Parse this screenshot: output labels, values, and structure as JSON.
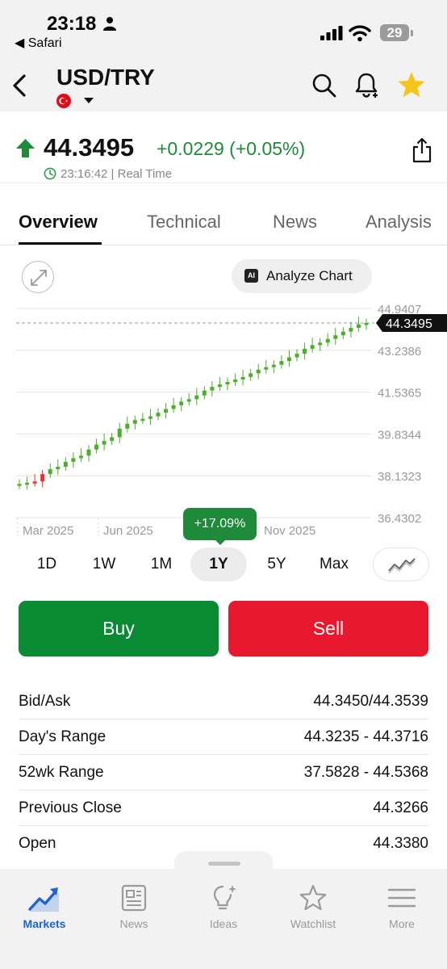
{
  "status_bar": {
    "time": "23:18",
    "back_app": "◀ Safari",
    "battery": "29"
  },
  "header": {
    "title": "USD/TRY"
  },
  "quote": {
    "price": "44.3495",
    "change": "+0.0229 (+0.05%)",
    "time": "23:16:42 | Real Time",
    "direction": "up"
  },
  "tabs": [
    {
      "label": "Overview",
      "active": true
    },
    {
      "label": "Technical",
      "active": false
    },
    {
      "label": "News",
      "active": false
    },
    {
      "label": "Analysis",
      "active": false
    }
  ],
  "chart_controls": {
    "analyze_label": "Analyze Chart",
    "ai_badge": "AI"
  },
  "chart_data": {
    "type": "candlestick",
    "y_ticks": [
      "44.9407",
      "43.2386",
      "41.5365",
      "39.8344",
      "38.1323",
      "36.4302"
    ],
    "y_range": [
      36.4302,
      44.9407
    ],
    "x_ticks": [
      "Mar 2025",
      "Jun 2025",
      "Nov 2025"
    ],
    "last_price_label": "44.3495",
    "last_price": 44.3495,
    "grid": true,
    "period_change": "+17.09%",
    "series": [
      {
        "values": [
          37.8,
          37.85,
          37.9,
          38.2,
          38.4,
          38.5,
          38.7,
          38.85,
          38.95,
          39.2,
          39.4,
          39.55,
          39.7,
          40.05,
          40.25,
          40.4,
          40.45,
          40.55,
          40.7,
          40.85,
          41.0,
          41.15,
          41.25,
          41.4,
          41.6,
          41.75,
          41.85,
          41.95,
          42.05,
          42.15,
          42.3,
          42.45,
          42.55,
          42.65,
          42.8,
          42.95,
          43.1,
          43.3,
          43.45,
          43.55,
          43.7,
          43.85,
          44.0,
          44.15,
          44.3,
          44.35
        ]
      }
    ]
  },
  "periods": [
    {
      "label": "1D",
      "active": false
    },
    {
      "label": "1W",
      "active": false
    },
    {
      "label": "1M",
      "active": false
    },
    {
      "label": "1Y",
      "active": true
    },
    {
      "label": "5Y",
      "active": false
    },
    {
      "label": "Max",
      "active": false
    }
  ],
  "actions": {
    "buy": "Buy",
    "sell": "Sell"
  },
  "stats": [
    {
      "label": "Bid/Ask",
      "value": "44.3450/44.3539"
    },
    {
      "label": "Day's Range",
      "value": "44.3235 - 44.3716"
    },
    {
      "label": "52wk Range",
      "value": "37.5828 - 44.5368"
    },
    {
      "label": "Previous Close",
      "value": "44.3266"
    },
    {
      "label": "Open",
      "value": "44.3380"
    }
  ],
  "bottom_nav": [
    {
      "label": "Markets",
      "icon": "markets-chart-icon",
      "active": true
    },
    {
      "label": "News",
      "icon": "newspaper-icon",
      "active": false
    },
    {
      "label": "Ideas",
      "icon": "lightbulb-icon",
      "active": false
    },
    {
      "label": "Watchlist",
      "icon": "star-outline-icon",
      "active": false
    },
    {
      "label": "More",
      "icon": "hamburger-menu-icon",
      "active": false
    }
  ],
  "colors": {
    "up": "#1e8a3a",
    "buy": "#0b8a34",
    "sell": "#e8192f",
    "accent_blue": "#1c63d6",
    "star": "#f5c518",
    "candle_up": "#4caf2c",
    "candle_down": "#e0322e"
  }
}
